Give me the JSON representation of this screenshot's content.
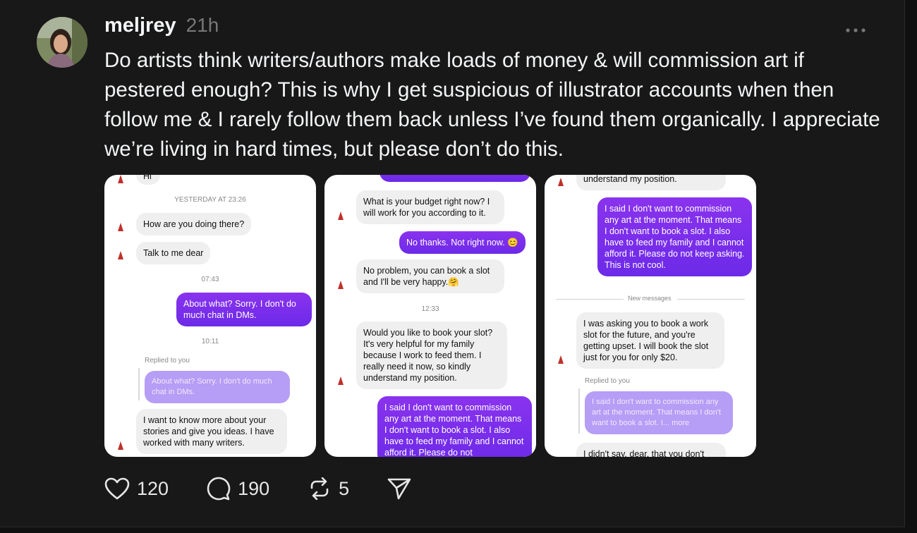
{
  "post": {
    "username": "meljrey",
    "time": "21h",
    "more_icon": "more-horizontal-icon",
    "text": "Do artists think writers/authors make loads of money & will commission art if pestered enough? This is why I get suspicious of illustrator accounts when then follow me & I rarely follow them back unless I’ve found them organically. I appreciate we’re living in hard times, but please don’t do this."
  },
  "screenshot1": {
    "top_stub": "Hi",
    "stamp1": "YESTERDAY AT 23:26",
    "m1": "How are you doing there?",
    "m2": "Talk to me dear",
    "stamp2": "07:43",
    "m3": "About what? Sorry. I don't do much chat in DMs.",
    "stamp3": "10:11",
    "replied": "Replied to you",
    "reply_quote": "About what? Sorry. I don't do much chat in DMs.",
    "m4": "I want to know more about your stories and give you ideas. I have worked with many writers."
  },
  "screenshot2": {
    "m1": "What is your budget right now? I will work for you according to it.",
    "m2": "No thanks. Not right now. 😊",
    "m3": "No problem, you can book a slot and I'll be very happy.🤗",
    "stamp1": "12:33",
    "m4": "Would you like to book your slot? It's very helpful for my family because I work to feed them. I really need it now, so kindly understand my position.",
    "m5": "I said I don't want to commission any art at the moment. That means I don't want to book a slot. I also have to feed my family and I cannot afford it. Please do not"
  },
  "screenshot3": {
    "m0": "understand my position.",
    "m1": "I said I don't want to commission any art at the moment. That means I don't want to book a slot. I also have to feed my family and I cannot afford it. Please do not keep asking. This is not cool.",
    "new_messages": "New messages",
    "m2": "I was asking you to book a work slot for the future, and you're getting upset. I will book the slot just for you for only $20.",
    "replied": "Replied to you",
    "reply_quote": "I said I don't want to commission any art at the moment. That means I don't want to book a slot. I... more",
    "m3": "I didn't say, dear, that you don't"
  },
  "actions": {
    "likes": "120",
    "comments": "190",
    "reposts": "5",
    "like_icon": "heart-icon",
    "comment_icon": "comment-bubble-icon",
    "repost_icon": "repost-icon",
    "share_icon": "send-icon"
  }
}
